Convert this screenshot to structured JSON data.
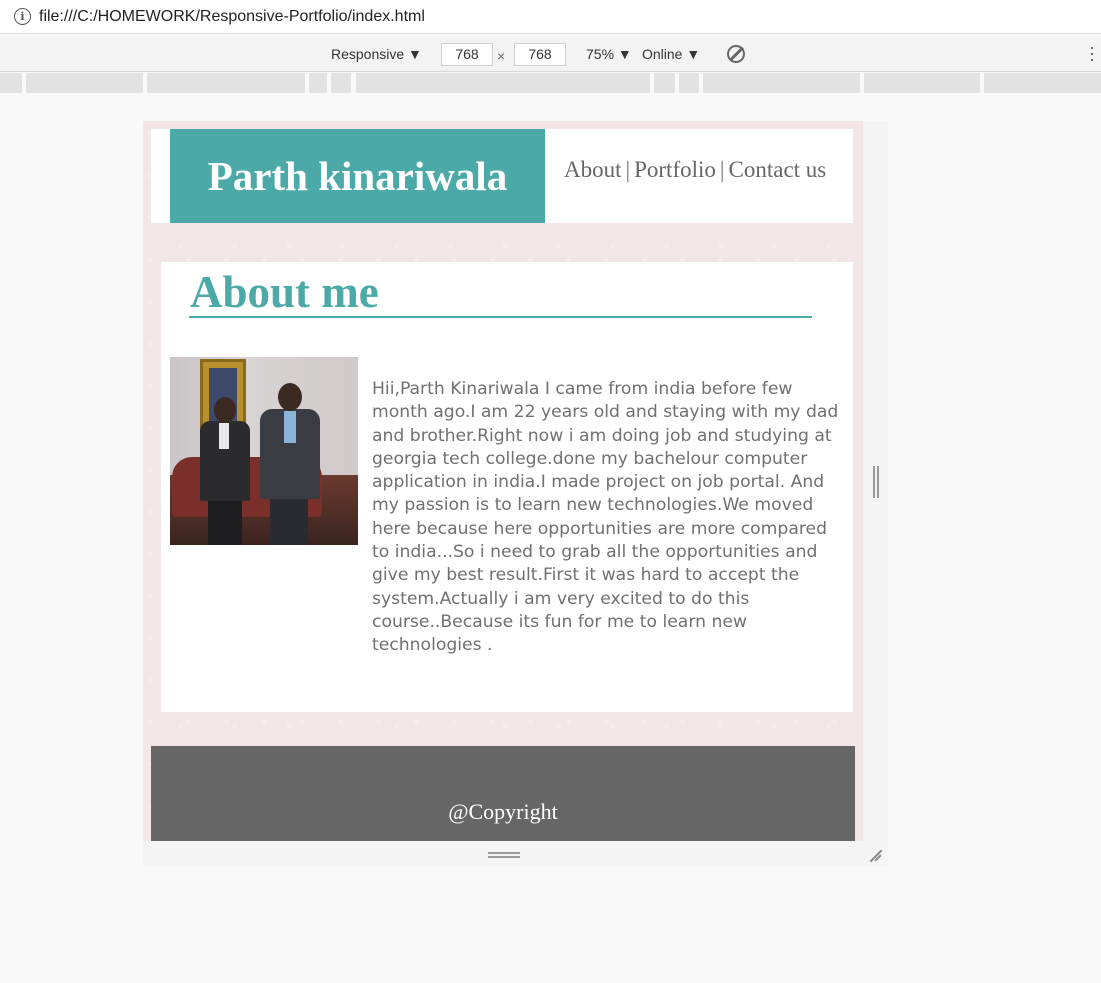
{
  "browser": {
    "url": "file:///C:/HOMEWORK/Responsive-Portfolio/index.html"
  },
  "device_toolbar": {
    "device": "Responsive",
    "width": "768",
    "times": "×",
    "height": "768",
    "zoom": "75%",
    "network": "Online"
  },
  "site": {
    "brand": "Parth kinariwala",
    "nav": {
      "about": "About",
      "separator": "|",
      "portfolio": "Portfolio",
      "contact": "Contact us"
    },
    "about": {
      "title": "About me",
      "text": "Hii,Parth Kinariwala I came from india before few month ago.I am 22 years old and staying with my dad and brother.Right now i am doing job and studying at georgia tech college.done my bachelour computer application in india.I made project on job portal. And my passion is to learn new technologies.We moved here because here opportunities are more compared to india...So i need to grab all the opportunities and give my best result.First it was hard to accept the system.Actually i am very excited to do this course..Because its fun for me to learn new technologies ."
    },
    "footer": {
      "copyright": "@Copyright"
    }
  },
  "colors": {
    "accent": "#4ba9a7",
    "footer": "#666666",
    "page_background": "#f3e6e6"
  }
}
